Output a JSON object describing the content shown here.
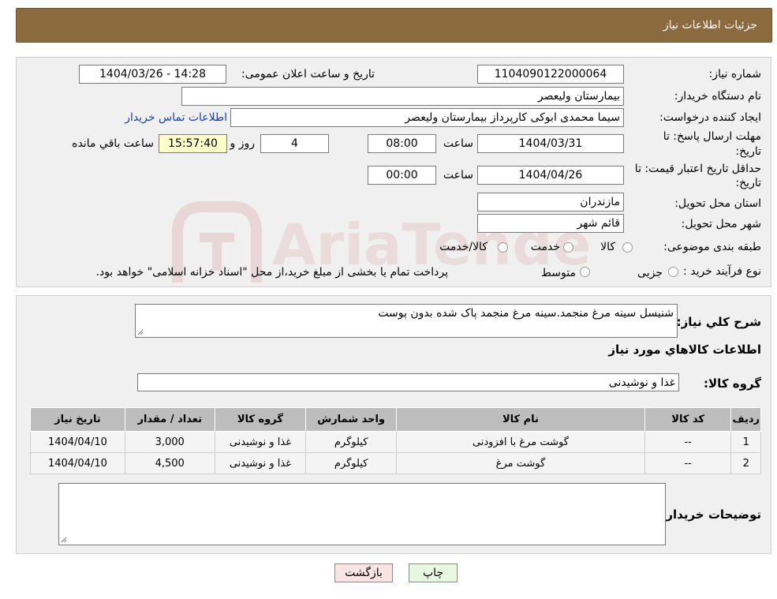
{
  "header": {
    "title": "جزئیات اطلاعات نیاز"
  },
  "form": {
    "need_number_label": "شماره نیاز:",
    "need_number": "1104090122000064",
    "announce_label": "تاریخ و ساعت اعلان عمومی:",
    "announce_value": "1404/03/26 - 14:28",
    "buyer_org_label": "نام دستگاه خریدار:",
    "buyer_org": "بیمارستان ولیعصر",
    "requester_label": "ایجاد کننده درخواست:",
    "requester": "سیما محمدی ابوکی کارپرداز بیمارستان ولیعصر",
    "contact_link": "اطلاعات تماس خریدار",
    "deadline_label_1": "مهلت ارسال پاسخ: تا",
    "deadline_label_2": "تاریخ:",
    "deadline_date": "1404/03/31",
    "time_label": "ساعت",
    "deadline_time": "08:00",
    "days_value": "4",
    "days_label": "روز و",
    "remaining_time": "15:57:40",
    "remaining_label": "ساعت باقي مانده",
    "validity_label_1": "حداقل تاریخ اعتبار قیمت: تا",
    "validity_label_2": "تاریخ:",
    "validity_date": "1404/04/26",
    "validity_time": "00:00",
    "province_label": "استان محل تحویل:",
    "province": "مازندران",
    "city_label": "شهر محل تحویل:",
    "city": "قائم شهر",
    "category_label": "طبقه بندی موضوعی:",
    "category_options": [
      "کالا",
      "خدمت",
      "کالا/خدمت"
    ],
    "process_label": "نوع فرآیند خرید :",
    "process_options": [
      "جزیی",
      "متوسط"
    ],
    "process_note": "پرداخت تمام یا بخشی از مبلغ خرید،از محل \"اسناد خزانه اسلامی\" خواهد بود."
  },
  "description": {
    "label": "شرح کلي نياز:",
    "value": "شنیسل سینه مرغ منجمد.سینه مرغ منجمد پاک شده بدون پوست"
  },
  "goods": {
    "section_title": "اطلاعات کالاهاي مورد نياز",
    "group_label": "گروه کالا:",
    "group_value": "غذا و نوشیدنی",
    "columns": [
      "رديف",
      "کد کالا",
      "نام کالا",
      "واحد شمارش",
      "گروه کالا",
      "تعداد / مقدار",
      "تاريخ نياز"
    ],
    "rows": [
      [
        "1",
        "--",
        "گوشت مرغ با افزودنی",
        "کیلوگرم",
        "غذا و نوشیدنی",
        "3,000",
        "1404/04/10"
      ],
      [
        "2",
        "--",
        "گوشت مرغ",
        "کیلوگرم",
        "غذا و نوشیدنی",
        "4,500",
        "1404/04/10"
      ]
    ]
  },
  "buyer_notes": {
    "label": "توضیحات خریدار:",
    "value": ""
  },
  "buttons": {
    "print": "چاپ",
    "back": "بازگشت"
  },
  "colors": {
    "header_bg": "#8b6a3f",
    "panel_bg": "#f0f0f0",
    "print_bg": "#e8f7e0",
    "back_bg": "#fde4e4",
    "link": "#1b3fa8"
  },
  "watermark": {
    "text": "AriaTender.neT"
  }
}
